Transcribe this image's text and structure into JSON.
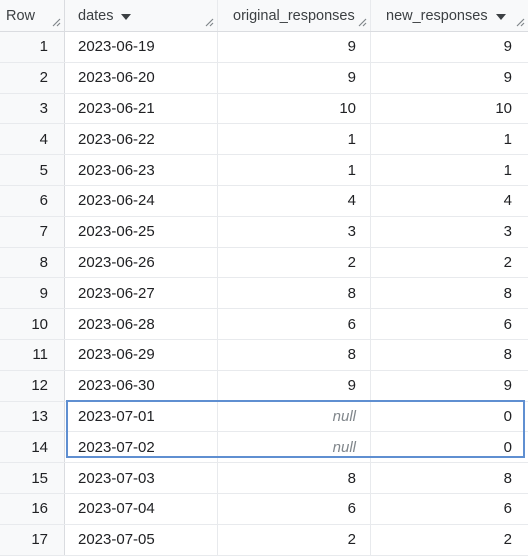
{
  "columns": {
    "row": "Row",
    "dates": "dates",
    "original": "original_responses",
    "new": "new_responses"
  },
  "rows": [
    {
      "row": "1",
      "dates": "2023-06-19",
      "original": "9",
      "new": "9"
    },
    {
      "row": "2",
      "dates": "2023-06-20",
      "original": "9",
      "new": "9"
    },
    {
      "row": "3",
      "dates": "2023-06-21",
      "original": "10",
      "new": "10"
    },
    {
      "row": "4",
      "dates": "2023-06-22",
      "original": "1",
      "new": "1"
    },
    {
      "row": "5",
      "dates": "2023-06-23",
      "original": "1",
      "new": "1"
    },
    {
      "row": "6",
      "dates": "2023-06-24",
      "original": "4",
      "new": "4"
    },
    {
      "row": "7",
      "dates": "2023-06-25",
      "original": "3",
      "new": "3"
    },
    {
      "row": "8",
      "dates": "2023-06-26",
      "original": "2",
      "new": "2"
    },
    {
      "row": "9",
      "dates": "2023-06-27",
      "original": "8",
      "new": "8"
    },
    {
      "row": "10",
      "dates": "2023-06-28",
      "original": "6",
      "new": "6"
    },
    {
      "row": "11",
      "dates": "2023-06-29",
      "original": "8",
      "new": "8"
    },
    {
      "row": "12",
      "dates": "2023-06-30",
      "original": "9",
      "new": "9"
    },
    {
      "row": "13",
      "dates": "2023-07-01",
      "original": "null",
      "new": "0"
    },
    {
      "row": "14",
      "dates": "2023-07-02",
      "original": "null",
      "new": "0"
    },
    {
      "row": "15",
      "dates": "2023-07-03",
      "original": "8",
      "new": "8"
    },
    {
      "row": "16",
      "dates": "2023-07-04",
      "original": "6",
      "new": "6"
    },
    {
      "row": "17",
      "dates": "2023-07-05",
      "original": "2",
      "new": "2"
    }
  ],
  "icons": {
    "sort": "caret-down-icon",
    "resize": "column-resize-icon"
  },
  "colors": {
    "selection_border": "#5f8fd1",
    "null_text": "#80868b",
    "header_bg": "#f8f9fa"
  }
}
